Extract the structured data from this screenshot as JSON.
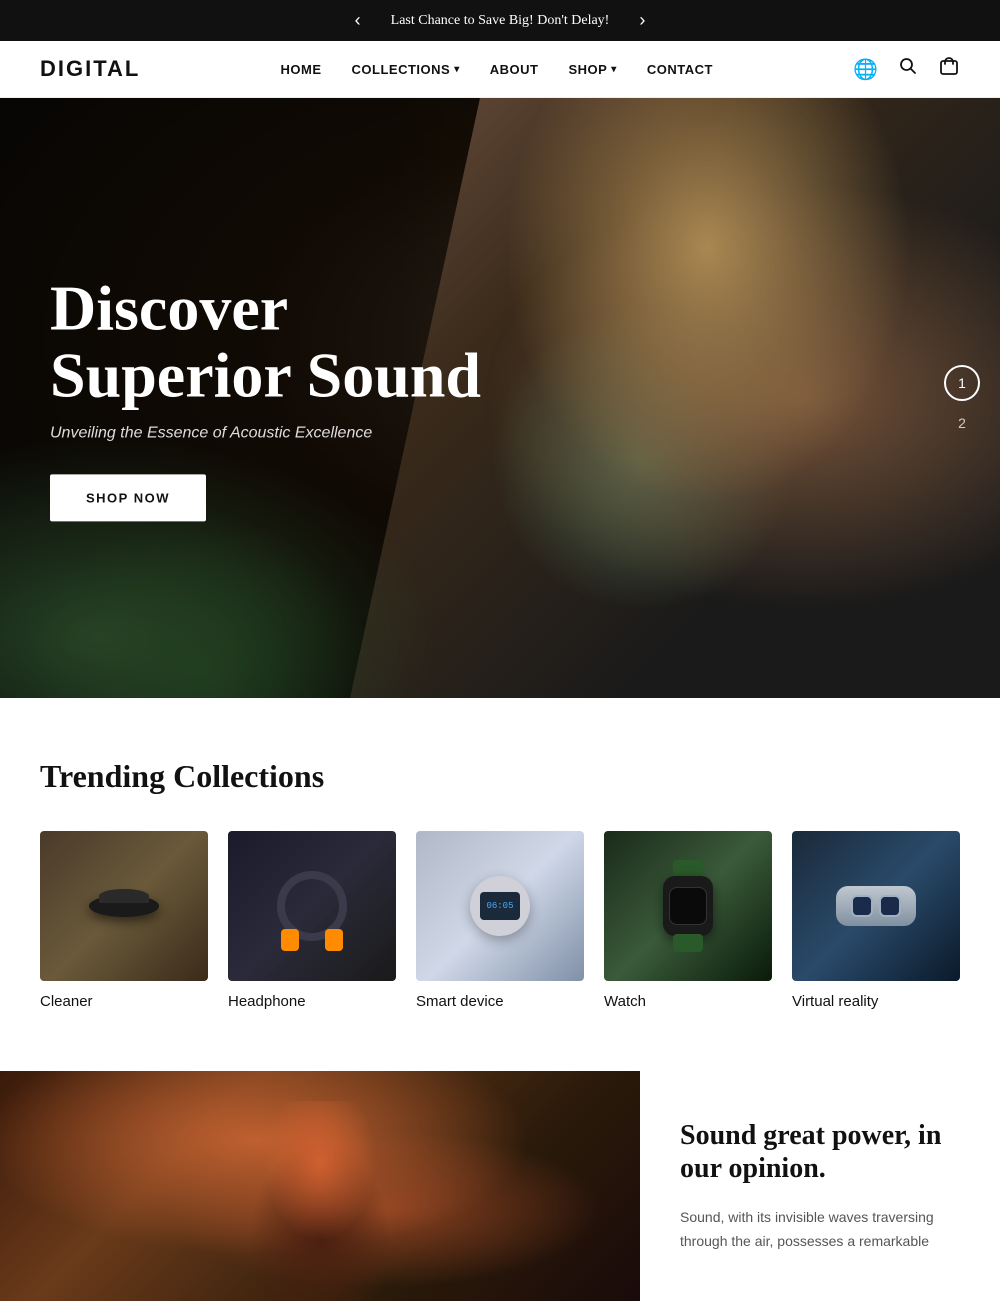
{
  "announcement": {
    "text": "Last Chance to Save Big! Don't Delay!",
    "prev_label": "‹",
    "next_label": "›"
  },
  "header": {
    "logo": "DIGITAL",
    "nav": [
      {
        "label": "HOME",
        "has_dropdown": false
      },
      {
        "label": "COLLECTIONS",
        "has_dropdown": true
      },
      {
        "label": "ABOUT",
        "has_dropdown": false
      },
      {
        "label": "SHOP",
        "has_dropdown": true
      },
      {
        "label": "CONTACT",
        "has_dropdown": false
      }
    ],
    "icons": {
      "globe": "🌐",
      "search": "🔍",
      "cart": "🛍"
    }
  },
  "hero": {
    "title_line1": "Discover",
    "title_line2": "Superior Sound",
    "subtitle": "Unveiling the Essence of Acoustic Excellence",
    "cta_label": "SHOP NOW",
    "pagination": [
      "1",
      "2"
    ]
  },
  "trending": {
    "section_title": "Trending Collections",
    "items": [
      {
        "label": "Cleaner",
        "type": "cleaner"
      },
      {
        "label": "Headphone",
        "type": "headphone"
      },
      {
        "label": "Smart device",
        "type": "smart"
      },
      {
        "label": "Watch",
        "type": "watch"
      },
      {
        "label": "Virtual reality",
        "type": "vr"
      }
    ]
  },
  "feature": {
    "title": "Sound great power, in our opinion.",
    "text": "Sound, with its invisible waves traversing through the air, possesses a remarkable"
  }
}
